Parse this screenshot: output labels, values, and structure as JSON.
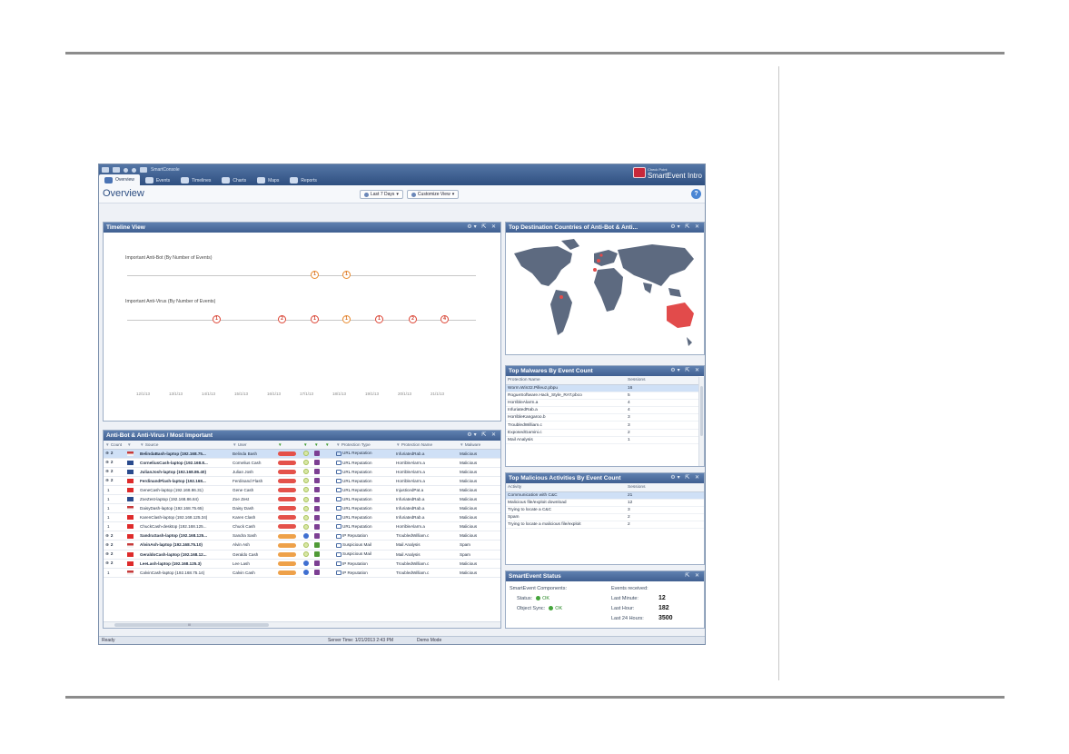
{
  "app": {
    "qat_label": "SmartConsole",
    "brand": {
      "line1": "Check Point",
      "line2": "SmartEvent Intro"
    },
    "tabs": [
      {
        "label": "Overview",
        "icon": "overview-icon"
      },
      {
        "label": "Events",
        "icon": "events-icon"
      },
      {
        "label": "Timelines",
        "icon": "timelines-icon"
      },
      {
        "label": "Charts",
        "icon": "charts-icon"
      },
      {
        "label": "Maps",
        "icon": "maps-icon"
      },
      {
        "label": "Reports",
        "icon": "reports-icon"
      }
    ],
    "overview_title": "Overview",
    "toolbar": {
      "range": "Last 7 Days",
      "customize": "Customize View"
    },
    "help": "?"
  },
  "timeline": {
    "title": "Timeline View",
    "antibot_label": "Important Anti-Bot (By Number of Events)",
    "antivirus_label": "Important Anti-Virus (By Number of Events)",
    "antibot_marks": [
      {
        "v": "1",
        "sev": "high"
      },
      {
        "v": "1",
        "sev": "high"
      }
    ],
    "antivirus_marks": [
      {
        "v": "1",
        "sev": "crit"
      },
      {
        "v": "2",
        "sev": "crit"
      },
      {
        "v": "1",
        "sev": "crit"
      },
      {
        "v": "1",
        "sev": "high"
      },
      {
        "v": "1",
        "sev": "crit"
      },
      {
        "v": "2",
        "sev": "crit"
      },
      {
        "v": "4",
        "sev": "crit"
      }
    ],
    "ticks": [
      "12/1/13",
      "13/1/13",
      "14/1/13",
      "15/1/13",
      "16/1/13",
      "17/1/13",
      "18/1/13",
      "19/1/13",
      "20/1/13",
      "21/1/13"
    ]
  },
  "events": {
    "title": "Anti-Bot & Anti-Virus / Most Important",
    "columns": [
      "Count",
      "",
      "Source",
      "User",
      "",
      "",
      "",
      "",
      "Protection Type",
      "Protection Name",
      "Malware"
    ],
    "rows": [
      {
        "exp": "⊕",
        "count": "2",
        "flag": "us",
        "source": "BelindaBash-laptop (192.168.75...",
        "user": "Belinda Bash",
        "sev": "crit",
        "conf": "y",
        "act": "p",
        "ptype": "URL Reputation",
        "pname": "InfuriatedRab.a",
        "mal": "Malicious",
        "bold": true,
        "sel": true
      },
      {
        "exp": "⊕",
        "count": "2",
        "flag": "uk",
        "source": "CorneliusCash-laptop (192.168.8...",
        "user": "Cornelius Cash",
        "sev": "crit",
        "conf": "y",
        "act": "p",
        "ptype": "URL Reputation",
        "pname": "HorribleAlarm.a",
        "mal": "Malicious",
        "bold": true,
        "sel": false
      },
      {
        "exp": "⊕",
        "count": "2",
        "flag": "uk",
        "source": "JulianJosh-laptop (192.168.86.40)",
        "user": "Julian Josh",
        "sev": "crit",
        "conf": "y",
        "act": "p",
        "ptype": "URL Reputation",
        "pname": "HorribleAlarm.a",
        "mal": "Malicious",
        "bold": true,
        "sel": false
      },
      {
        "exp": "⊕",
        "count": "2",
        "flag": "cn",
        "source": "FerdinandFlash-laptop (192.168...",
        "user": "Ferdinand Flash",
        "sev": "crit",
        "conf": "y",
        "act": "p",
        "ptype": "URL Reputation",
        "pname": "HorribleAlarm.a",
        "mal": "Malicious",
        "bold": true,
        "sel": false
      },
      {
        "exp": "",
        "count": "1",
        "flag": "cn",
        "source": "GeneCash-laptop (192.168.86.31)",
        "user": "Gene Cash",
        "sev": "crit",
        "conf": "y",
        "act": "p",
        "ptype": "URL Reputation",
        "pname": "InjusticedPat.a",
        "mal": "Malicious",
        "bold": false,
        "sel": false
      },
      {
        "exp": "",
        "count": "1",
        "flag": "uk",
        "source": "ZoeZest-laptop (192.168.86.84)",
        "user": "Zoe Zest",
        "sev": "crit",
        "conf": "y",
        "act": "p",
        "ptype": "URL Reputation",
        "pname": "InfuriatedRab.a",
        "mal": "Malicious",
        "bold": false,
        "sel": false
      },
      {
        "exp": "",
        "count": "1",
        "flag": "us",
        "source": "DaisyDash-laptop (192.168.75.65)",
        "user": "Daisy Dash",
        "sev": "crit",
        "conf": "y",
        "act": "p",
        "ptype": "URL Reputation",
        "pname": "InfuriatedRab.a",
        "mal": "Malicious",
        "bold": false,
        "sel": false
      },
      {
        "exp": "",
        "count": "1",
        "flag": "cn",
        "source": "KarenClash-laptop (192.168.125.34)",
        "user": "Karen Clash",
        "sev": "crit",
        "conf": "y",
        "act": "p",
        "ptype": "URL Reputation",
        "pname": "InfuriatedRab.a",
        "mal": "Malicious",
        "bold": false,
        "sel": false
      },
      {
        "exp": "",
        "count": "1",
        "flag": "cn",
        "source": "ChuckCash-desktop (192.168.125...",
        "user": "Chuck Cash",
        "sev": "crit",
        "conf": "y",
        "act": "p",
        "ptype": "URL Reputation",
        "pname": "HorribleAlarm.a",
        "mal": "Malicious",
        "bold": false,
        "sel": false
      },
      {
        "exp": "⊕",
        "count": "2",
        "flag": "cn",
        "source": "SandraSash-laptop (192.168.125...",
        "user": "Sandra Sash",
        "sev": "high",
        "conf": "b",
        "act": "p",
        "ptype": "IP Reputation",
        "pname": "TroubledWilliam.c",
        "mal": "Malicious",
        "bold": true,
        "sel": false
      },
      {
        "exp": "⊕",
        "count": "2",
        "flag": "us",
        "source": "AlvinAsh-laptop (192.168.75.10)",
        "user": "Alvin Ash",
        "sev": "high",
        "conf": "y",
        "act": "g",
        "ptype": "Suspicious Mail",
        "pname": "Mail Analysis",
        "mal": "Spam",
        "bold": true,
        "sel": false
      },
      {
        "exp": "⊕",
        "count": "2",
        "flag": "cn",
        "source": "GeraldoCash-laptop (192.168.12...",
        "user": "Geraldo Cash",
        "sev": "high",
        "conf": "y",
        "act": "g",
        "ptype": "Suspicious Mail",
        "pname": "Mail Analysis",
        "mal": "Spam",
        "bold": true,
        "sel": false
      },
      {
        "exp": "⊕",
        "count": "2",
        "flag": "cn",
        "source": "LeeLash-laptop (192.168.125.3)",
        "user": "Lee Lash",
        "sev": "high",
        "conf": "b",
        "act": "p",
        "ptype": "IP Reputation",
        "pname": "TroubledWilliam.c",
        "mal": "Malicious",
        "bold": true,
        "sel": false
      },
      {
        "exp": "",
        "count": "1",
        "flag": "us",
        "source": "CalvinCash-laptop (192.168.75.14)",
        "user": "Calvin Cash",
        "sev": "high",
        "conf": "b",
        "act": "p",
        "ptype": "IP Reputation",
        "pname": "TroubledWilliam.c",
        "mal": "Malicious",
        "bold": false,
        "sel": false
      }
    ],
    "scroll_marker": "III"
  },
  "map": {
    "title": "Top Destination Countries of Anti-Bot & Anti..."
  },
  "malwares": {
    "title": "Top Malwares By Event Count",
    "headers": [
      "Protection Name",
      "Sessions"
    ],
    "rows": [
      [
        "Worm.Win32.Pilleuz.pbpu",
        "16"
      ],
      [
        "RogueSoftware.Hack_Style_RAT.pbco",
        "5"
      ],
      [
        "HorribleAlarm.a",
        "4"
      ],
      [
        "InfuriatedRab.a",
        "4"
      ],
      [
        "HorribleKangaroo.b",
        "3"
      ],
      [
        "TroubledWilliam.c",
        "3"
      ],
      [
        "ExposedGamini.c",
        "2"
      ],
      [
        "Mail Analysis",
        "1"
      ]
    ]
  },
  "activities": {
    "title": "Top Malicious Activities By Event Count",
    "headers": [
      "Activity",
      "Sessions"
    ],
    "rows": [
      [
        "Communication with C&C",
        "21"
      ],
      [
        "Malicious file/exploit download",
        "12"
      ],
      [
        "Trying to locate a C&C",
        "3"
      ],
      [
        "Spam",
        "2"
      ],
      [
        "Trying to locate a malicious file/exploit",
        "2"
      ]
    ]
  },
  "status": {
    "title": "SmartEvent Status",
    "components_label": "SmartEvent Components:",
    "status_label": "Status:",
    "status_val": "OK",
    "sync_label": "Object Sync:",
    "sync_val": "OK",
    "received_label": "Events received:",
    "last_minute_label": "Last Minute:",
    "last_minute": "12",
    "last_hour_label": "Last Hour:",
    "last_hour": "182",
    "last_24_label": "Last 24 Hours:",
    "last_24": "3500"
  },
  "statusbar": {
    "ready": "Ready",
    "server_time": "Server Time: 1/21/2013 2:43 PM",
    "mode": "Demo Mode"
  },
  "colors": {
    "header_blue": "#4e6fa2",
    "critical": "#e4514a",
    "high": "#eea14a",
    "ok": "#43a43a"
  }
}
